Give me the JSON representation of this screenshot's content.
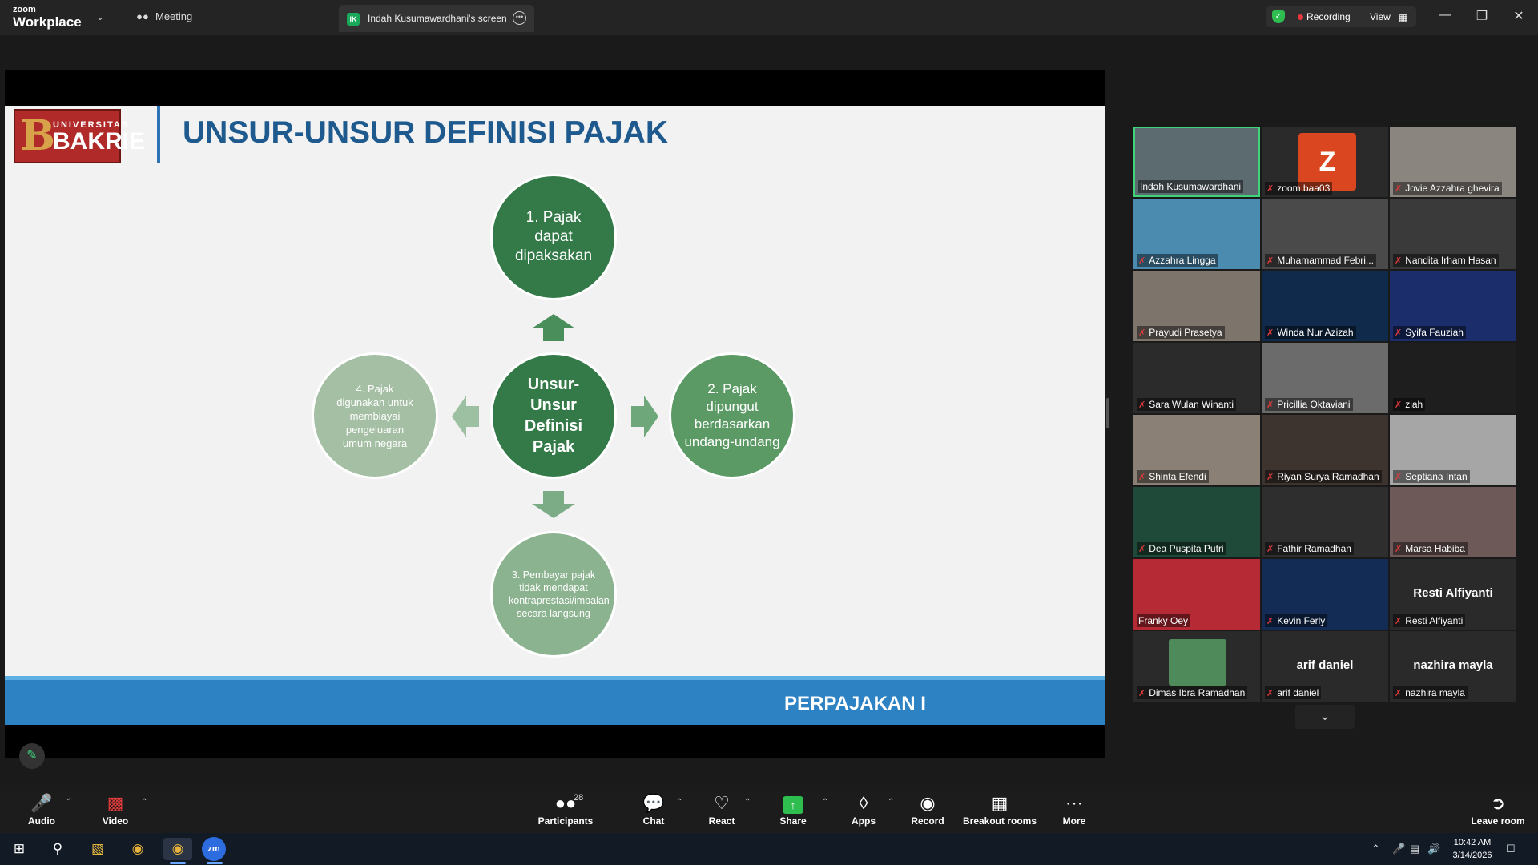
{
  "titlebar": {
    "logo_line1": "zoom",
    "logo_line2": "Workplace",
    "tab_meeting": "Meeting",
    "share_initials": "IK",
    "tab_share": "Indah Kusumawardhani's screen",
    "recording": "Recording",
    "view": "View"
  },
  "slide": {
    "logo_top": "UNIVERSITAS",
    "logo_bottom": "BAKRIE",
    "logo_letter": "B",
    "title": "UNSUR-UNSUR DEFINISI PAJAK",
    "center": "Unsur-Unsur Definisi Pajak",
    "item1": "1. Pajak dapat dipaksakan",
    "item2": "2. Pajak dipungut berdasarkan undang-undang",
    "item3": "3. Pembayar pajak tidak mendapat kontraprestasi/imbalan secara langsung",
    "item4": "4. Pajak digunakan untuk membiayai pengeluaran umum negara",
    "footer": "PERPAJAKAN I"
  },
  "gallery": {
    "avatar_letter": "Z",
    "participants": [
      "Indah Kusumawardhani",
      "zoom baa03",
      "Jovie Azzahra ghevira",
      "Azzahra Lingga",
      "Muhamammad Febri...",
      "Nandita Irham Hasan",
      "Prayudi Prasetya",
      "Winda Nur Azizah",
      "Syifa Fauziah",
      "Sara Wulan Winanti",
      "Pricillia Oktaviani",
      "ziah",
      "Shinta Efendi",
      "Riyan Surya Ramadhan",
      "Septiana Intan",
      "Dea Puspita Putri",
      "Fathir Ramadhan",
      "Marsa Habiba",
      "Franky Oey",
      "Kevin Ferly",
      "Resti Alfiyanti",
      "Dimas Ibra Ramadhan",
      "arif daniel",
      "nazhira mayla"
    ],
    "center_names": {
      "resti": "Resti Alfiyanti",
      "arif": "arif daniel",
      "nazhira": "nazhira mayla"
    }
  },
  "toolbar": {
    "audio": "Audio",
    "video": "Video",
    "participants": "Participants",
    "participants_count": "28",
    "chat": "Chat",
    "react": "React",
    "share": "Share",
    "apps": "Apps",
    "record": "Record",
    "breakout": "Breakout rooms",
    "more": "More",
    "leave": "Leave room"
  },
  "taskbar": {
    "time": "10:42 AM",
    "date": "3/14/2026",
    "zoom_label": "zm"
  },
  "colors": {
    "accent_green": "#2ebd4f",
    "slide_title": "#1f5a8f",
    "slide_footer": "#2d82c4",
    "circle_dark": "#337a48"
  }
}
